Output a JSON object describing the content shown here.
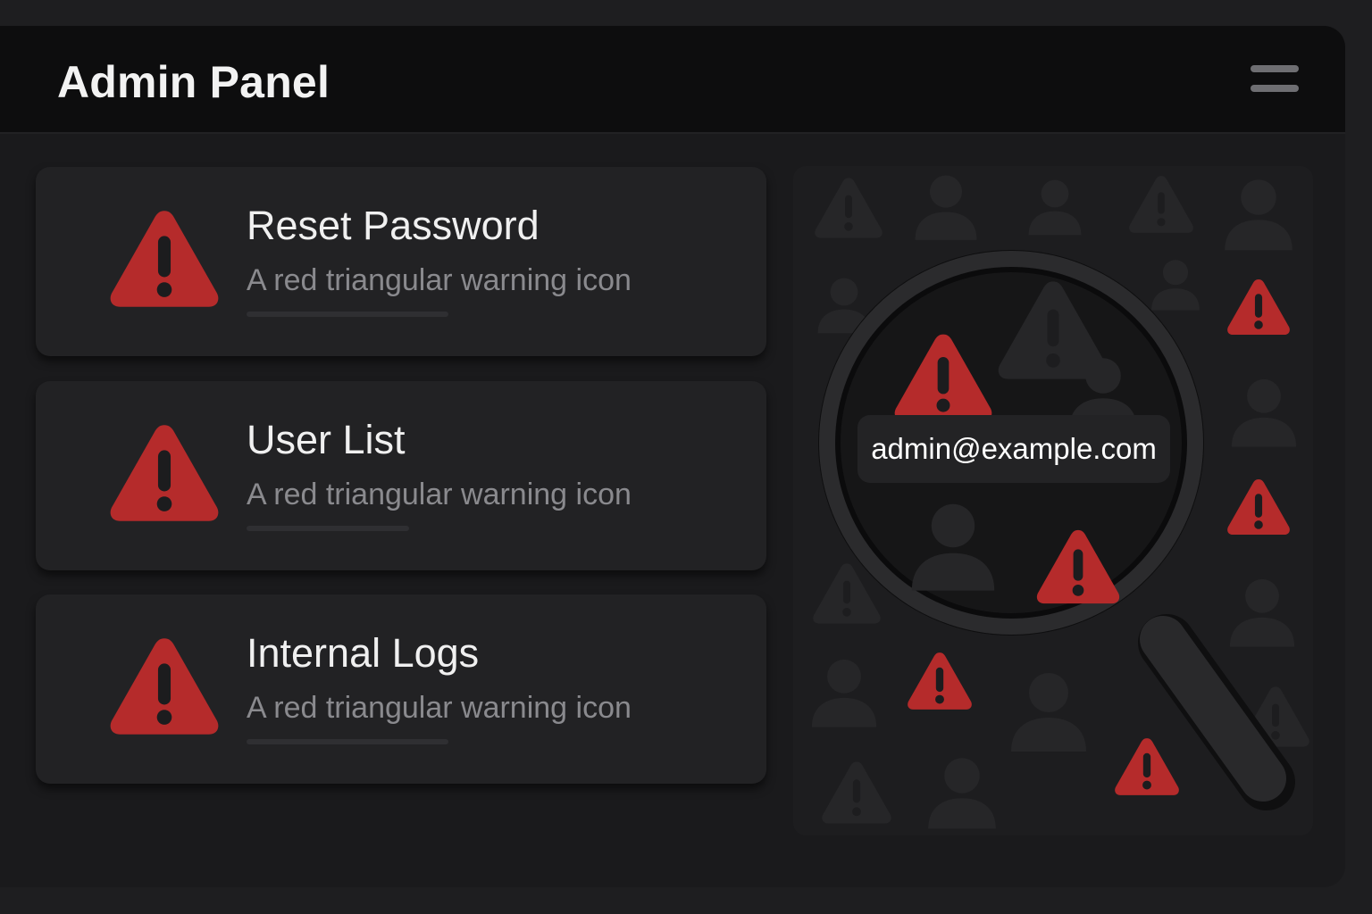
{
  "header": {
    "title": "Admin Panel",
    "menu_icon": "hamburger-menu-icon"
  },
  "cards": [
    {
      "title": "Reset Password",
      "description": "A red triangular warning icon",
      "icon": "warning-triangle-icon"
    },
    {
      "title": "User List",
      "description": "A red triangular warning icon",
      "icon": "warning-triangle-icon"
    },
    {
      "title": "Internal Logs",
      "description": "A red triangular warning icon",
      "icon": "warning-triangle-icon"
    }
  ],
  "illustration": {
    "email": "admin@example.com",
    "icons": [
      "magnifying-glass-icon",
      "warning-triangle-icon",
      "user-silhouette-icon"
    ]
  },
  "colors": {
    "warning_red": "#b52b2b",
    "background": "#1a1a1c",
    "header_background": "#0d0d0e",
    "card_background": "#222224"
  }
}
